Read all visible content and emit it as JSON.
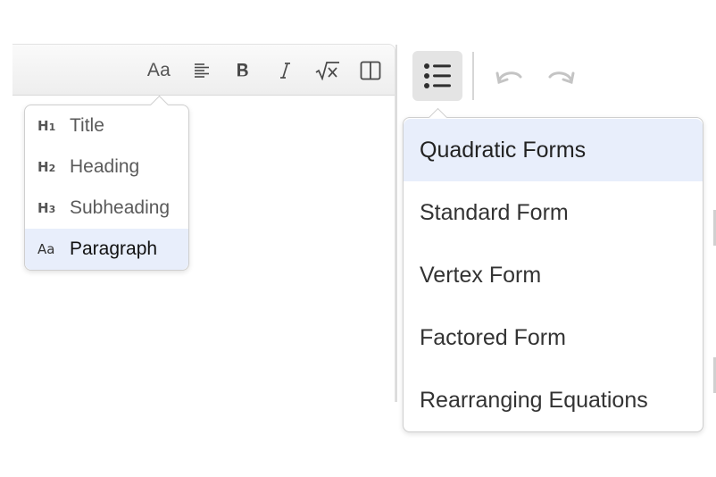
{
  "toolbar": {
    "text_style_label": "Aa",
    "icons": [
      "text-style-icon",
      "align-icon",
      "bold-icon",
      "italic-icon",
      "math-icon",
      "split-view-icon",
      "list-icon",
      "undo-icon",
      "redo-icon"
    ]
  },
  "text_style_menu": {
    "items": [
      {
        "icon": "H",
        "level": "1",
        "label": "Title"
      },
      {
        "icon": "H",
        "level": "2",
        "label": "Heading"
      },
      {
        "icon": "H",
        "level": "3",
        "label": "Subheading"
      },
      {
        "icon": "Aa",
        "level": "",
        "label": "Paragraph",
        "selected": true
      }
    ]
  },
  "outline_menu": {
    "items": [
      {
        "label": "Quadratic Forms",
        "selected": true
      },
      {
        "label": "Standard Form"
      },
      {
        "label": "Vertex Form"
      },
      {
        "label": "Factored Form"
      },
      {
        "label": "Rearranging Equations"
      }
    ]
  },
  "colors": {
    "selected_bg": "#e8eefb",
    "toolbar_bg": "#eeeeee",
    "icon": "#4a4a4a",
    "disabled_icon": "#c4c4c4"
  }
}
